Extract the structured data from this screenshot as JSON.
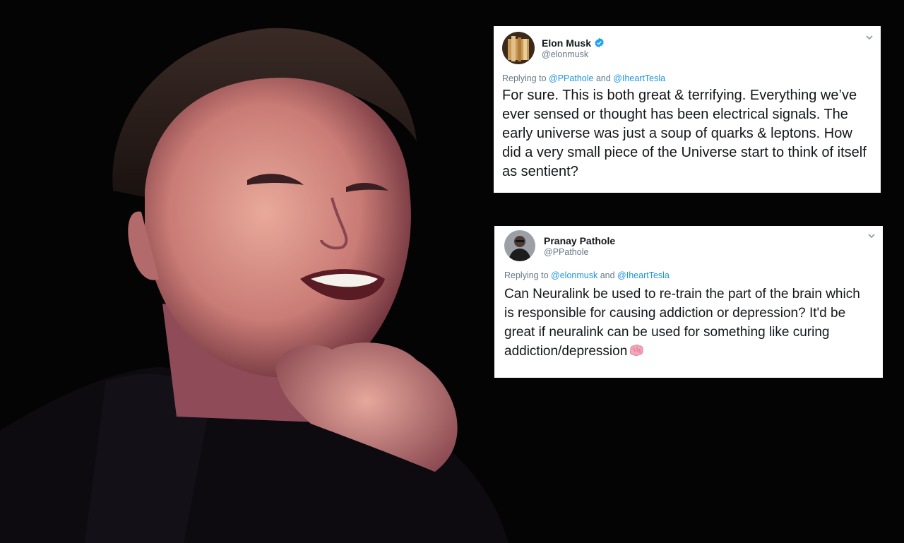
{
  "tweets": [
    {
      "name": "Elon Musk",
      "verified": true,
      "handle": "@elonmusk",
      "replying_prefix": "Replying to",
      "replying_to": [
        "@PPathole",
        "@IheartTesla"
      ],
      "replying_joiner": "and",
      "body": "For sure. This is both great & terrifying. Everything we’ve ever sensed or thought has been electrical signals. The early universe was just a soup of quarks & leptons. How did a very small piece of the Universe start to think of itself as sentient?",
      "avatar_icon": "profile-photo-icon"
    },
    {
      "name": "Pranay Pathole",
      "verified": false,
      "handle": "@PPathole",
      "replying_prefix": "Replying to",
      "replying_to": [
        "@elonmusk",
        "@IheartTesla"
      ],
      "replying_joiner": "and",
      "body": "Can Neuralink be used to re-train the part of the brain which is responsible for causing addiction or depression? It'd be great if neuralink can be used for something like curing addiction/depression",
      "emoji": "brain-emoji-icon",
      "avatar_icon": "profile-photo-icon"
    }
  ],
  "colors": {
    "background": "#040405",
    "card": "#ffffff",
    "text": "#14171a",
    "muted": "#657786",
    "link": "#1b95e0",
    "verified": "#1da1f2"
  }
}
